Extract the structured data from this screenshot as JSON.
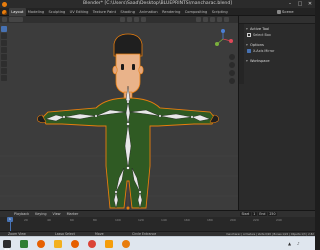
{
  "window": {
    "title": "Blender* [C:\\Users\\Saad\\Desktop\\BLUEPRINTS\\mancharac.blend]",
    "minimize_glyph": "–",
    "maximize_glyph": "□",
    "close_glyph": "✕"
  },
  "workspace_tabs": [
    "Layout",
    "Modeling",
    "Sculpting",
    "UV Editing",
    "Texture Paint",
    "Shading",
    "Animation",
    "Rendering",
    "Compositing",
    "Scripting"
  ],
  "scene": {
    "label": "Scene"
  },
  "properties_panel": {
    "active_tool": {
      "header": "Active Tool",
      "tool_label": "Select Box"
    },
    "options": {
      "header": "Options",
      "x_axis_mirror": "X-Axis Mirror"
    },
    "workspace": {
      "header": "Workspace"
    }
  },
  "timeline": {
    "menu": [
      "Playback",
      "Keying",
      "View",
      "Marker"
    ],
    "current_frame": "1",
    "frame_fields": [
      "Start",
      "1",
      "End",
      "250"
    ],
    "ticks": [
      "0",
      "20",
      "40",
      "60",
      "80",
      "100",
      "120",
      "140",
      "160",
      "180",
      "200",
      "220",
      "240"
    ]
  },
  "statusbar": {
    "left": "Zoom View",
    "mid1": "Lasso Select",
    "mid2": "Move",
    "center": "Circle Entrance",
    "right": "mancharac | Armature | Verts:0/20 | Bones:1/22 | Objects:1/3 | 2.82"
  },
  "colors": {
    "accent": "#4772b3",
    "character_orange": "#e87d0d",
    "suit_green": "#2f5a23",
    "bone_white": "#e8e8e8"
  },
  "taskbar_icons": [
    "windows-start-icon",
    "folder-icon",
    "blender-icon",
    "word-icon",
    "firefox-icon",
    "chrome-icon",
    "excel-icon",
    "vlc-icon",
    "blender-icon-2"
  ]
}
